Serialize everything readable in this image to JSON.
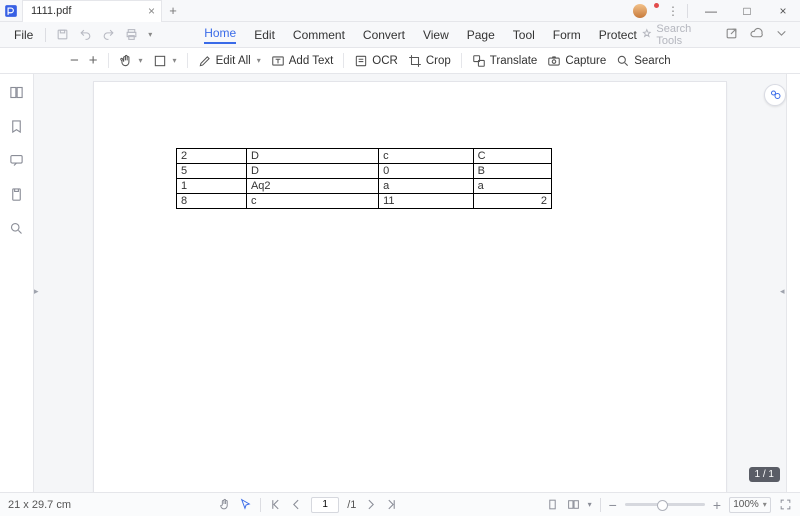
{
  "app": {
    "tab_title": "1111.pdf",
    "file_menu": "File"
  },
  "menus": {
    "home": "Home",
    "edit": "Edit",
    "comment": "Comment",
    "convert": "Convert",
    "view": "View",
    "page": "Page",
    "tool": "Tool",
    "form": "Form",
    "protect": "Protect",
    "search_tools": "Search Tools"
  },
  "toolbar": {
    "edit_all": "Edit All",
    "add_text": "Add Text",
    "ocr": "OCR",
    "crop": "Crop",
    "translate": "Translate",
    "capture": "Capture",
    "search": "Search"
  },
  "status": {
    "page_size": "21 x 29.7 cm",
    "page_current": "1",
    "page_total": "/1",
    "pager_badge": "1 / 1",
    "zoom": "100%"
  },
  "table": [
    [
      "2",
      "D",
      "c",
      "C"
    ],
    [
      "5",
      "D",
      "0",
      "B"
    ],
    [
      "1",
      "Aq2",
      "a",
      "a"
    ],
    [
      "8",
      "c",
      "11",
      "2"
    ]
  ],
  "glyph": {
    "plus": "+",
    "minus": "−",
    "close": "×",
    "chev": "▾",
    "tri_l": "◂",
    "tri_r": "▸",
    "dots": "⋮",
    "sq": "□",
    "min": "—",
    "max": "▢"
  }
}
